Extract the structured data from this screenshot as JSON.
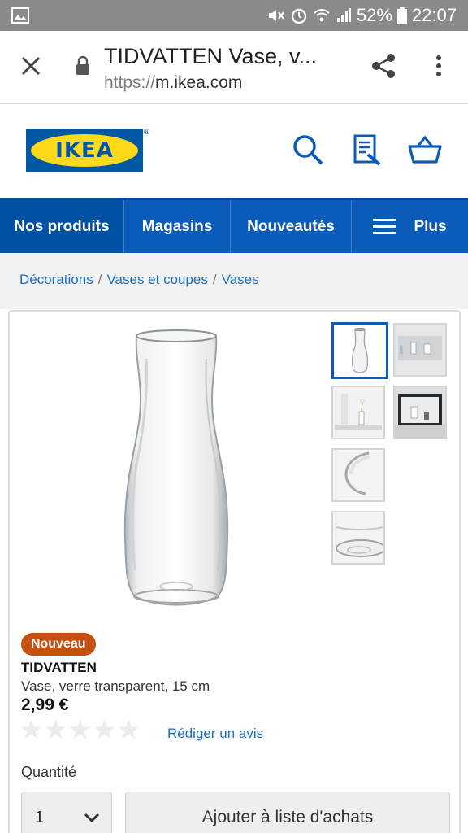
{
  "status_bar": {
    "battery": "52%",
    "time": "22:07",
    "icons": [
      "gallery-icon",
      "mute-icon",
      "alarm-icon",
      "wifi-icon",
      "signal-icon",
      "battery-icon"
    ]
  },
  "browser": {
    "page_title": "TIDVATTEN Vase, v...",
    "url_scheme": "https://",
    "url_host": "m.ikea.com",
    "icons": [
      "close-icon",
      "lock-icon",
      "share-icon",
      "more-vert-icon"
    ]
  },
  "header": {
    "logo_text": "IKEA",
    "logo_reg": "®",
    "icons": [
      "search-icon",
      "shopping-list-icon",
      "basket-icon"
    ],
    "colors": {
      "brand_blue": "#0058a3",
      "brand_yellow": "#ffda1a"
    }
  },
  "nav": {
    "items": [
      {
        "label": "Nos produits"
      },
      {
        "label": "Magasins"
      },
      {
        "label": "Nouveautés"
      },
      {
        "label": "Plus",
        "icon": "menu-icon"
      }
    ],
    "color": "#0a5cb8"
  },
  "breadcrumb": {
    "items": [
      "Décorations",
      "Vases et coupes",
      "Vases"
    ],
    "separator": "/"
  },
  "product": {
    "badge": "Nouveau",
    "name": "TIDVATTEN",
    "description": "Vase, verre transparent, 15 cm",
    "price": "2,99 €",
    "rating": 0,
    "rating_max": 5,
    "review_link": "Rédiger un avis",
    "quantity_label": "Quantité",
    "quantity_value": "1",
    "add_to_list": "Ajouter à liste d'achats",
    "thumbnail_count": 6,
    "badge_color": "#c8500f"
  }
}
